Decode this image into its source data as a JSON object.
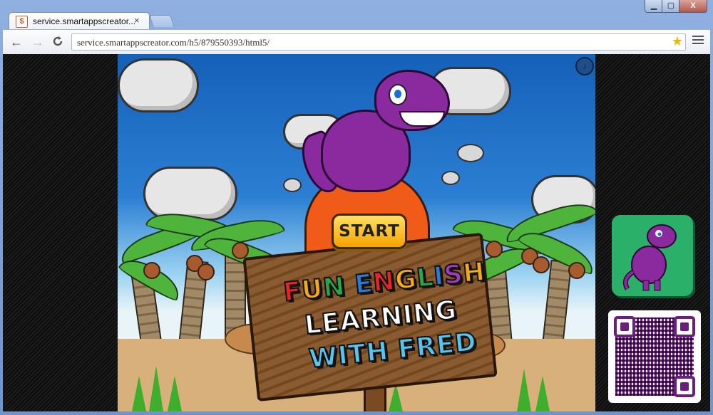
{
  "browser": {
    "tab_title": "service.smartappscreator...",
    "tab_close": "×",
    "favicon": "smartapps-favicon",
    "window_controls": {
      "minimize": "▁",
      "maximize": "▢",
      "close": "X"
    },
    "nav": {
      "back": "←",
      "forward": "→",
      "reload": "C"
    },
    "url": "service.smartappscreator.com/h5/879550393/html5/",
    "bookmark_icon": "★"
  },
  "game": {
    "start_label": "START",
    "title_lines": [
      {
        "text": "FUN ENGLISH",
        "colors": [
          "#e8232a",
          "#f3a917",
          "#27a84a",
          "#2a7ad8",
          "#e8232a",
          "#f3a917",
          "#27a84a",
          "#2a7ad8",
          "#a33bc2",
          "#f3a917",
          "#e8232a"
        ]
      },
      {
        "text": "LEARNING"
      },
      {
        "text": "WITH FRED"
      }
    ],
    "sound_icon": "sound-icon",
    "dino_name": "Fred"
  },
  "sidebar": {
    "app_icon": "dino-app-icon",
    "qr_code": "qr-code"
  },
  "colors": {
    "sky_top": "#1560b9",
    "volcano": "#f05c18",
    "dino": "#8a2a9e",
    "start_button": "#f6a300",
    "app_icon_bg": "#2bb06a",
    "qr_fg": "#6a1f7c"
  }
}
